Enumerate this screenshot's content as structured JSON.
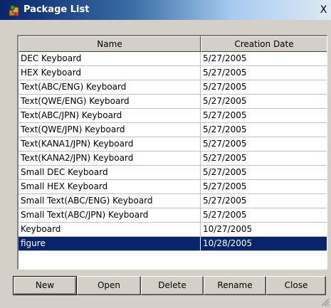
{
  "window": {
    "title": "Package List",
    "close_glyph": "X"
  },
  "icons": {
    "title_icon": "package-icon",
    "close_icon": "close-icon",
    "grip_icon": "resize-grip-icon"
  },
  "colors": {
    "title_gradient_start": "#0a246a",
    "title_gradient_end": "#dfe9f5",
    "selection": "#0a246a",
    "face": "#d4d0c8"
  },
  "list": {
    "columns": [
      "Name",
      "Creation Date"
    ],
    "rows": [
      {
        "name": "DEC Keyboard",
        "date": "5/27/2005"
      },
      {
        "name": "HEX Keyboard",
        "date": "5/27/2005"
      },
      {
        "name": "Text(ABC/ENG) Keyboard",
        "date": "5/27/2005"
      },
      {
        "name": "Text(QWE/ENG) Keyboard",
        "date": "5/27/2005"
      },
      {
        "name": "Text(ABC/JPN) Keyboard",
        "date": "5/27/2005"
      },
      {
        "name": "Text(QWE/JPN) Keyboard",
        "date": "5/27/2005"
      },
      {
        "name": "Text(KANA1/JPN) Keyboard",
        "date": "5/27/2005"
      },
      {
        "name": "Text(KANA2/JPN) Keyboard",
        "date": "5/27/2005"
      },
      {
        "name": "Small DEC Keyboard",
        "date": "5/27/2005"
      },
      {
        "name": "Small HEX Keyboard",
        "date": "5/27/2005"
      },
      {
        "name": "Small Text(ABC/ENG) Keyboard",
        "date": "5/27/2005"
      },
      {
        "name": "Small Text(ABC/JPN) Keyboard",
        "date": "5/27/2005"
      },
      {
        "name": "Keyboard",
        "date": "10/27/2005"
      },
      {
        "name": "figure",
        "date": "10/28/2005",
        "selected": true
      }
    ]
  },
  "buttons": {
    "new": "New",
    "open": "Open",
    "delete": "Delete",
    "rename": "Rename",
    "close": "Close"
  }
}
